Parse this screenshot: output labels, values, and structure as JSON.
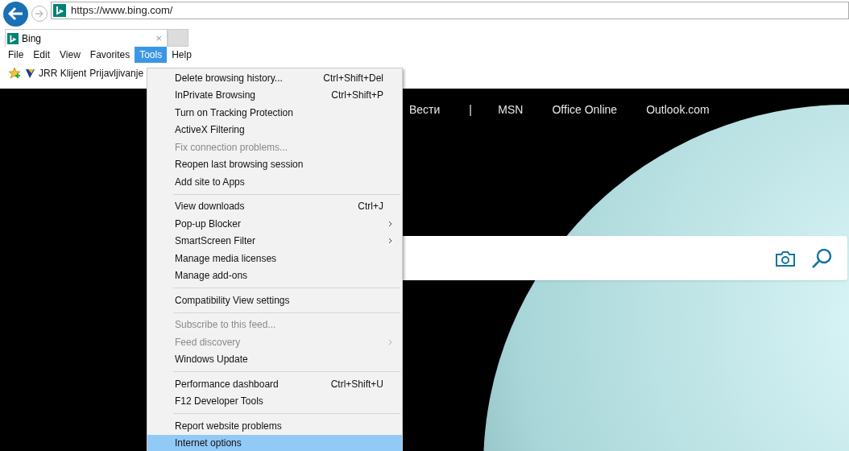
{
  "address_bar": {
    "url": "https://www.bing.com/"
  },
  "tabs": [
    {
      "title": "Bing",
      "close": "×",
      "selected": true
    }
  ],
  "menu_bar": [
    {
      "label": "File",
      "selected": false
    },
    {
      "label": "Edit",
      "selected": false
    },
    {
      "label": "View",
      "selected": false
    },
    {
      "label": "Favorites",
      "selected": false
    },
    {
      "label": "Tools",
      "selected": true
    },
    {
      "label": "Help",
      "selected": false
    }
  ],
  "favorites_bar": [
    {
      "label": "JRR Klijent"
    },
    {
      "label": "Prijavljivanje"
    }
  ],
  "page_nav": [
    {
      "label": "Вести",
      "kind": "link"
    },
    {
      "label": "|",
      "kind": "divider"
    },
    {
      "label": "MSN",
      "kind": "link"
    },
    {
      "label": "Office Online",
      "kind": "link"
    },
    {
      "label": "Outlook.com",
      "kind": "link"
    }
  ],
  "tools_menu": [
    [
      {
        "label": "Delete browsing history...",
        "shortcut": "Ctrl+Shift+Del",
        "submenu": false,
        "disabled": false,
        "selected": false
      },
      {
        "label": "InPrivate Browsing",
        "shortcut": "Ctrl+Shift+P",
        "submenu": false,
        "disabled": false,
        "selected": false
      },
      {
        "label": "Turn on Tracking Protection",
        "submenu": false,
        "disabled": false,
        "selected": false
      },
      {
        "label": "ActiveX Filtering",
        "submenu": false,
        "disabled": false,
        "selected": false
      },
      {
        "label": "Fix connection problems...",
        "submenu": false,
        "disabled": true,
        "selected": false
      },
      {
        "label": "Reopen last browsing session",
        "submenu": false,
        "disabled": false,
        "selected": false
      },
      {
        "label": "Add site to Apps",
        "submenu": false,
        "disabled": false,
        "selected": false
      }
    ],
    [
      {
        "label": "View downloads",
        "shortcut": "Ctrl+J",
        "submenu": false,
        "disabled": false,
        "selected": false
      },
      {
        "label": "Pop-up Blocker",
        "submenu": true,
        "disabled": false,
        "selected": false
      },
      {
        "label": "SmartScreen Filter",
        "submenu": true,
        "disabled": false,
        "selected": false
      },
      {
        "label": "Manage media licenses",
        "submenu": false,
        "disabled": false,
        "selected": false
      },
      {
        "label": "Manage add-ons",
        "submenu": false,
        "disabled": false,
        "selected": false
      }
    ],
    [
      {
        "label": "Compatibility View settings",
        "submenu": false,
        "disabled": false,
        "selected": false
      }
    ],
    [
      {
        "label": "Subscribe to this feed...",
        "submenu": false,
        "disabled": true,
        "selected": false
      },
      {
        "label": "Feed discovery",
        "submenu": true,
        "disabled": true,
        "selected": false
      },
      {
        "label": "Windows Update",
        "submenu": false,
        "disabled": false,
        "selected": false
      }
    ],
    [
      {
        "label": "Performance dashboard",
        "shortcut": "Ctrl+Shift+U",
        "submenu": false,
        "disabled": false,
        "selected": false
      },
      {
        "label": "F12 Developer Tools",
        "submenu": false,
        "disabled": false,
        "selected": false
      }
    ],
    [
      {
        "label": "Report website problems",
        "submenu": false,
        "disabled": false,
        "selected": false
      },
      {
        "label": "Internet options",
        "submenu": false,
        "disabled": false,
        "selected": true
      }
    ]
  ]
}
